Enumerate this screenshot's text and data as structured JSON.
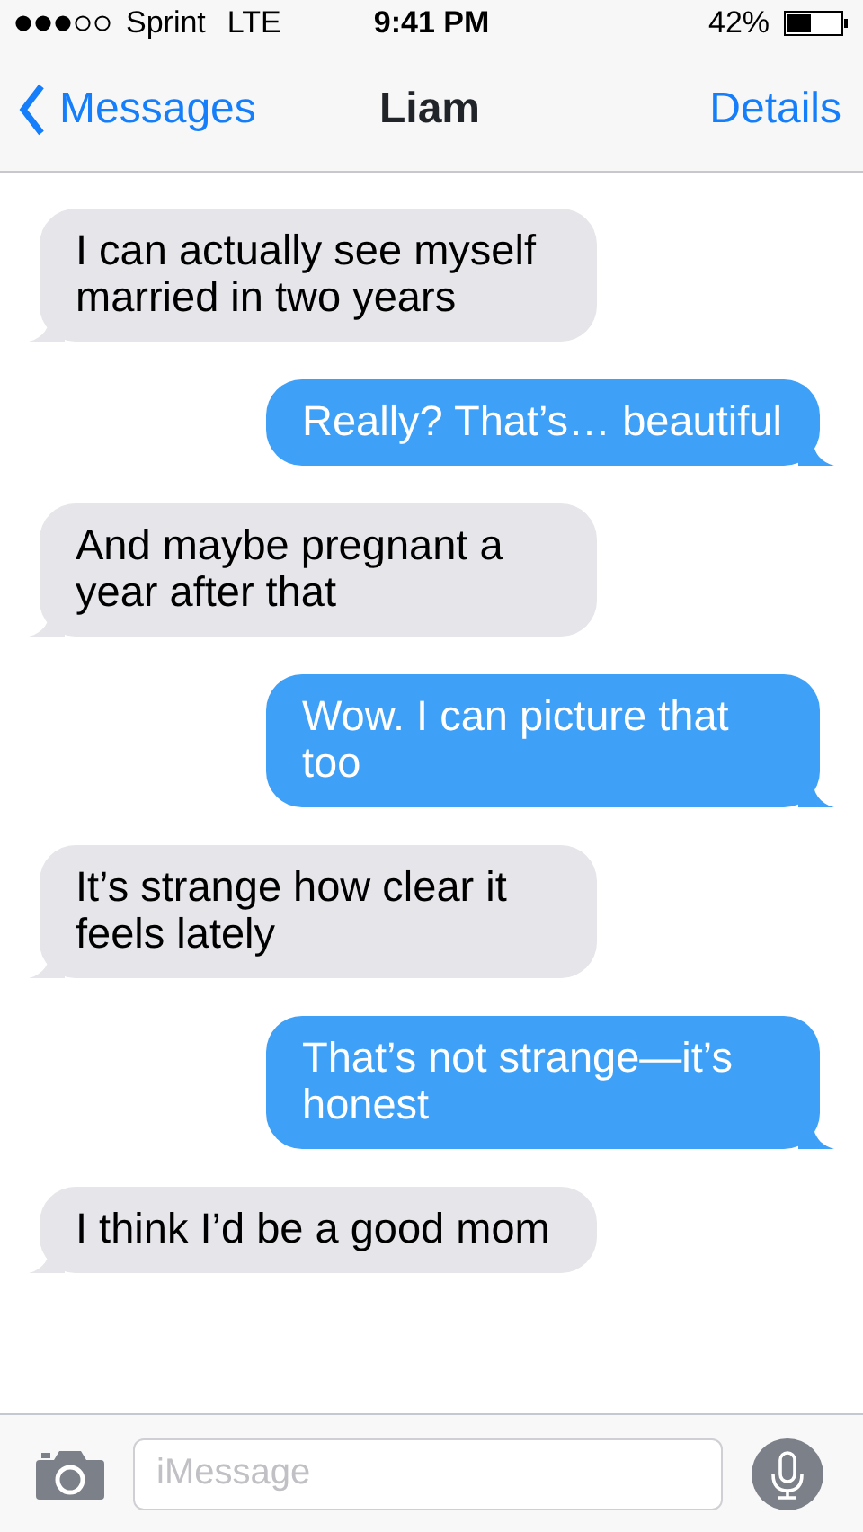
{
  "status_bar": {
    "carrier": "Sprint",
    "network": "LTE",
    "time": "9:41 PM",
    "battery": "42%"
  },
  "nav": {
    "back": "Messages",
    "title": "Liam",
    "action": "Details"
  },
  "messages": [
    {
      "kind": "incoming",
      "text": "I can actually see myself married in two years"
    },
    {
      "kind": "outgoing",
      "text": "Really? That’s… beautiful"
    },
    {
      "kind": "incoming",
      "text": "And maybe pregnant a year after that"
    },
    {
      "kind": "outgoing",
      "text": "Wow. I can picture that too"
    },
    {
      "kind": "incoming",
      "text": "It’s strange how clear it feels lately"
    },
    {
      "kind": "outgoing",
      "text": "That’s not strange—it’s honest"
    },
    {
      "kind": "incoming",
      "text": "I think I’d be a good mom"
    }
  ],
  "composer": {
    "placeholder": "iMessage"
  }
}
